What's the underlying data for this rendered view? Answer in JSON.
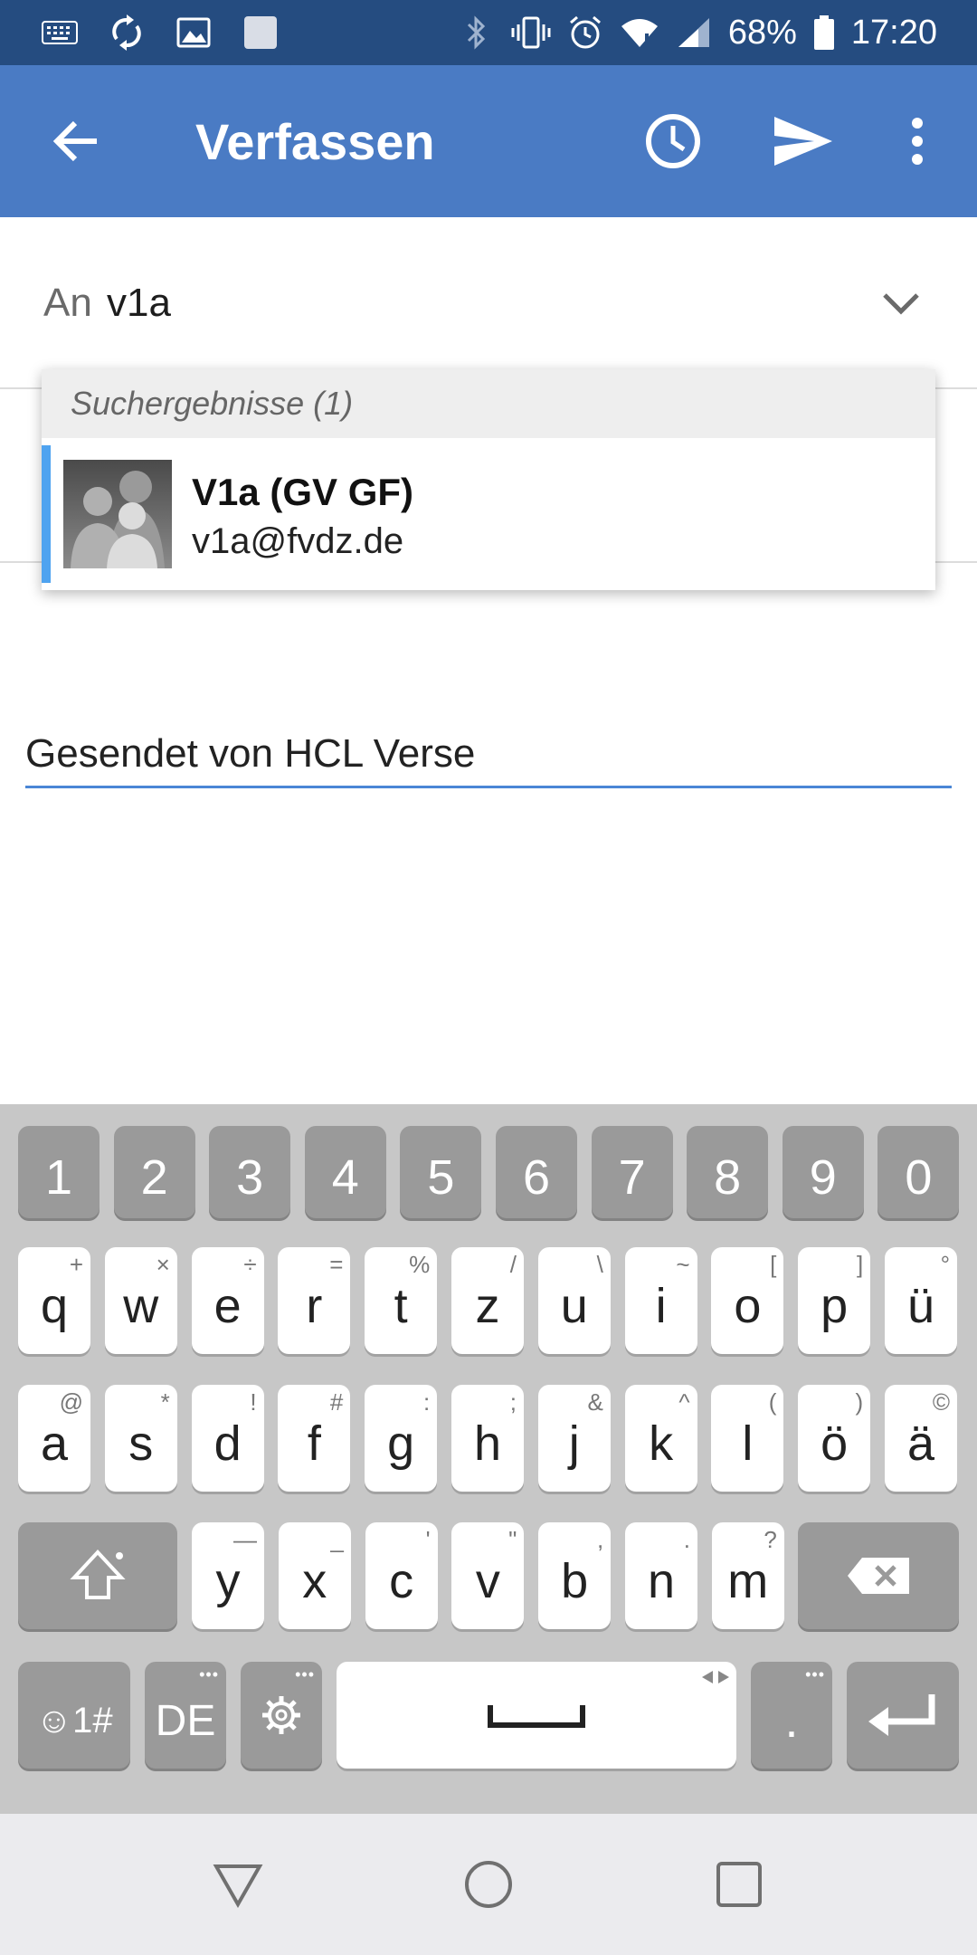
{
  "status_bar": {
    "battery_percent": "68%",
    "time": "17:20",
    "icons_left": [
      "keyboard-icon",
      "sync-icon",
      "image-icon",
      "square-icon"
    ],
    "icons_right": [
      "bluetooth-icon",
      "vibrate-icon",
      "alarm-icon",
      "wifi-icon",
      "signal-icon",
      "battery-icon"
    ]
  },
  "app_bar": {
    "title": "Verfassen",
    "actions": [
      "back-icon",
      "clock-icon",
      "send-icon",
      "overflow-menu-icon"
    ],
    "color": "#4a7bc4"
  },
  "compose": {
    "to_label": "An",
    "to_value": "v1a",
    "body_text": "Gesendet von HCL Verse"
  },
  "suggestions": {
    "header": "Suchergebnisse (1)",
    "items": [
      {
        "name": "V1a (GV GF)",
        "email": "v1a@fvdz.de"
      }
    ]
  },
  "keyboard": {
    "row_numbers": [
      "1",
      "2",
      "3",
      "4",
      "5",
      "6",
      "7",
      "8",
      "9",
      "0"
    ],
    "row1": [
      {
        "k": "q",
        "s": "+"
      },
      {
        "k": "w",
        "s": "×"
      },
      {
        "k": "e",
        "s": "÷"
      },
      {
        "k": "r",
        "s": "="
      },
      {
        "k": "t",
        "s": "%"
      },
      {
        "k": "z",
        "s": "/"
      },
      {
        "k": "u",
        "s": "\\"
      },
      {
        "k": "i",
        "s": "~"
      },
      {
        "k": "o",
        "s": "["
      },
      {
        "k": "p",
        "s": "]"
      },
      {
        "k": "ü",
        "s": "°"
      }
    ],
    "row2": [
      {
        "k": "a",
        "s": "@"
      },
      {
        "k": "s",
        "s": "*"
      },
      {
        "k": "d",
        "s": "!"
      },
      {
        "k": "f",
        "s": "#"
      },
      {
        "k": "g",
        "s": ":"
      },
      {
        "k": "h",
        "s": ";"
      },
      {
        "k": "j",
        "s": "&"
      },
      {
        "k": "k",
        "s": "^"
      },
      {
        "k": "l",
        "s": "("
      },
      {
        "k": "ö",
        "s": ")"
      },
      {
        "k": "ä",
        "s": "©"
      }
    ],
    "row3": [
      {
        "k": "y",
        "s": "—"
      },
      {
        "k": "x",
        "s": "_"
      },
      {
        "k": "c",
        "s": "'"
      },
      {
        "k": "v",
        "s": "\""
      },
      {
        "k": "b",
        "s": ","
      },
      {
        "k": "n",
        "s": "."
      },
      {
        "k": "m",
        "s": "?"
      }
    ],
    "symbols_key": "☺1#",
    "language_key": "DE",
    "period_key": ".",
    "more_dots": "•••"
  },
  "nav_bar": {
    "buttons": [
      "back-triangle-icon",
      "home-circle-icon",
      "recents-square-icon"
    ]
  }
}
